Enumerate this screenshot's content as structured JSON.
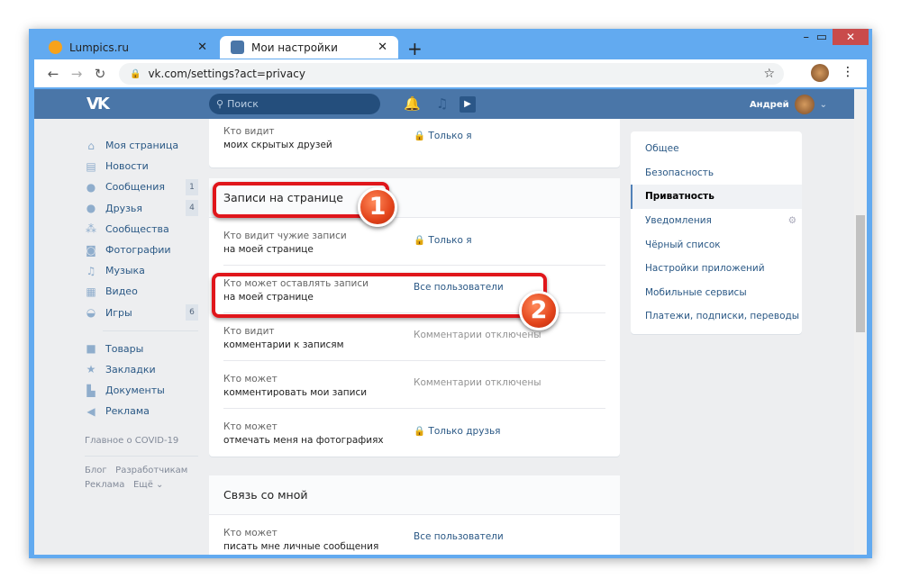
{
  "browser": {
    "tabs": [
      {
        "label": "Lumpics.ru"
      },
      {
        "label": "Мои настройки"
      }
    ],
    "url": "vk.com/settings?act=privacy"
  },
  "header": {
    "search_placeholder": "Поиск",
    "user": "Андрей",
    "color": "#4a76a8"
  },
  "sidebar": {
    "items": [
      {
        "label": "Моя страница",
        "icon": "home-icon"
      },
      {
        "label": "Новости",
        "icon": "news-icon"
      },
      {
        "label": "Сообщения",
        "icon": "messages-icon",
        "badge": "1"
      },
      {
        "label": "Друзья",
        "icon": "friends-icon",
        "badge": "4"
      },
      {
        "label": "Сообщества",
        "icon": "groups-icon"
      },
      {
        "label": "Фотографии",
        "icon": "camera-icon"
      },
      {
        "label": "Музыка",
        "icon": "music-icon"
      },
      {
        "label": "Видео",
        "icon": "video-icon"
      },
      {
        "label": "Игры",
        "icon": "gamepad-icon",
        "badge": "6"
      }
    ],
    "items2": [
      {
        "label": "Товары",
        "icon": "bag-icon"
      },
      {
        "label": "Закладки",
        "icon": "star-icon"
      },
      {
        "label": "Документы",
        "icon": "document-icon"
      },
      {
        "label": "Реклама",
        "icon": "megaphone-icon"
      }
    ],
    "covid": "Главное о COVID-19",
    "footer": {
      "blog": "Блог",
      "dev": "Разработчикам",
      "ads": "Реклама",
      "more": "Ещё"
    }
  },
  "main": {
    "top_row": {
      "q1": "Кто видит",
      "q2": "моих скрытых друзей",
      "value": "Только я"
    },
    "section1": {
      "title": "Записи на странице",
      "rows": [
        {
          "q1": "Кто видит чужие записи",
          "q2": "на моей странице",
          "value": "Только я",
          "locked": true
        },
        {
          "q1": "Кто может оставлять записи",
          "q2": "на моей странице",
          "value": "Все пользователи"
        },
        {
          "q1": "Кто видит",
          "q2": "комментарии к записям",
          "value": "Комментарии отключены"
        },
        {
          "q1": "Кто может",
          "q2": "комментировать мои записи",
          "value": "Комментарии отключены"
        },
        {
          "q1": "Кто может",
          "q2": "отмечать меня на фотографиях",
          "value": "Только друзья",
          "locked": true
        }
      ]
    },
    "section2": {
      "title": "Связь со мной",
      "rows": [
        {
          "q1": "Кто может",
          "q2": "писать мне личные сообщения",
          "value": "Все пользователи"
        }
      ]
    }
  },
  "menu": {
    "items": [
      "Общее",
      "Безопасность",
      "Приватность",
      "Уведомления",
      "Чёрный список",
      "Настройки приложений",
      "Мобильные сервисы",
      "Платежи, подписки, переводы"
    ],
    "active": "Приватность"
  },
  "annotations": [
    "1",
    "2"
  ]
}
